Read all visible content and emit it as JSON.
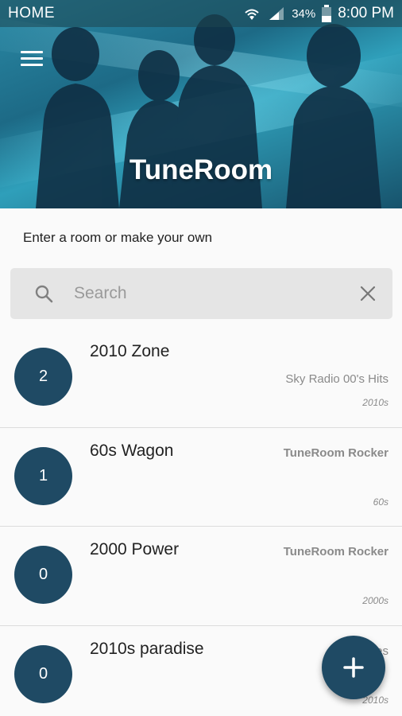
{
  "status_bar": {
    "left_label": "HOME",
    "battery_percent": "34%",
    "time": "8:00 PM"
  },
  "header": {
    "title": "TuneRoom"
  },
  "main": {
    "subtitle": "Enter a room or make your own",
    "search": {
      "placeholder": "Search",
      "value": ""
    }
  },
  "rooms": [
    {
      "count": "2",
      "name": "2010 Zone",
      "station": "Sky Radio 00's Hits",
      "station_bold": false,
      "genre": "2010s"
    },
    {
      "count": "1",
      "name": "60s Wagon",
      "station": "TuneRoom Rocker",
      "station_bold": true,
      "genre": "60s"
    },
    {
      "count": "0",
      "name": "2000 Power",
      "station": "TuneRoom Rocker",
      "station_bold": true,
      "genre": "2000s"
    },
    {
      "count": "0",
      "name": "2010s paradise",
      "station": "cutie-pies",
      "station_bold": false,
      "genre": "2010s"
    }
  ],
  "icons": {
    "menu": "menu-icon",
    "search": "search-icon",
    "clear": "close-icon",
    "fab": "plus-icon",
    "wifi": "wifi-icon",
    "signal": "signal-icon",
    "battery": "battery-icon"
  },
  "colors": {
    "accent": "#1f4a64",
    "status_bar": "#2b5a66"
  }
}
